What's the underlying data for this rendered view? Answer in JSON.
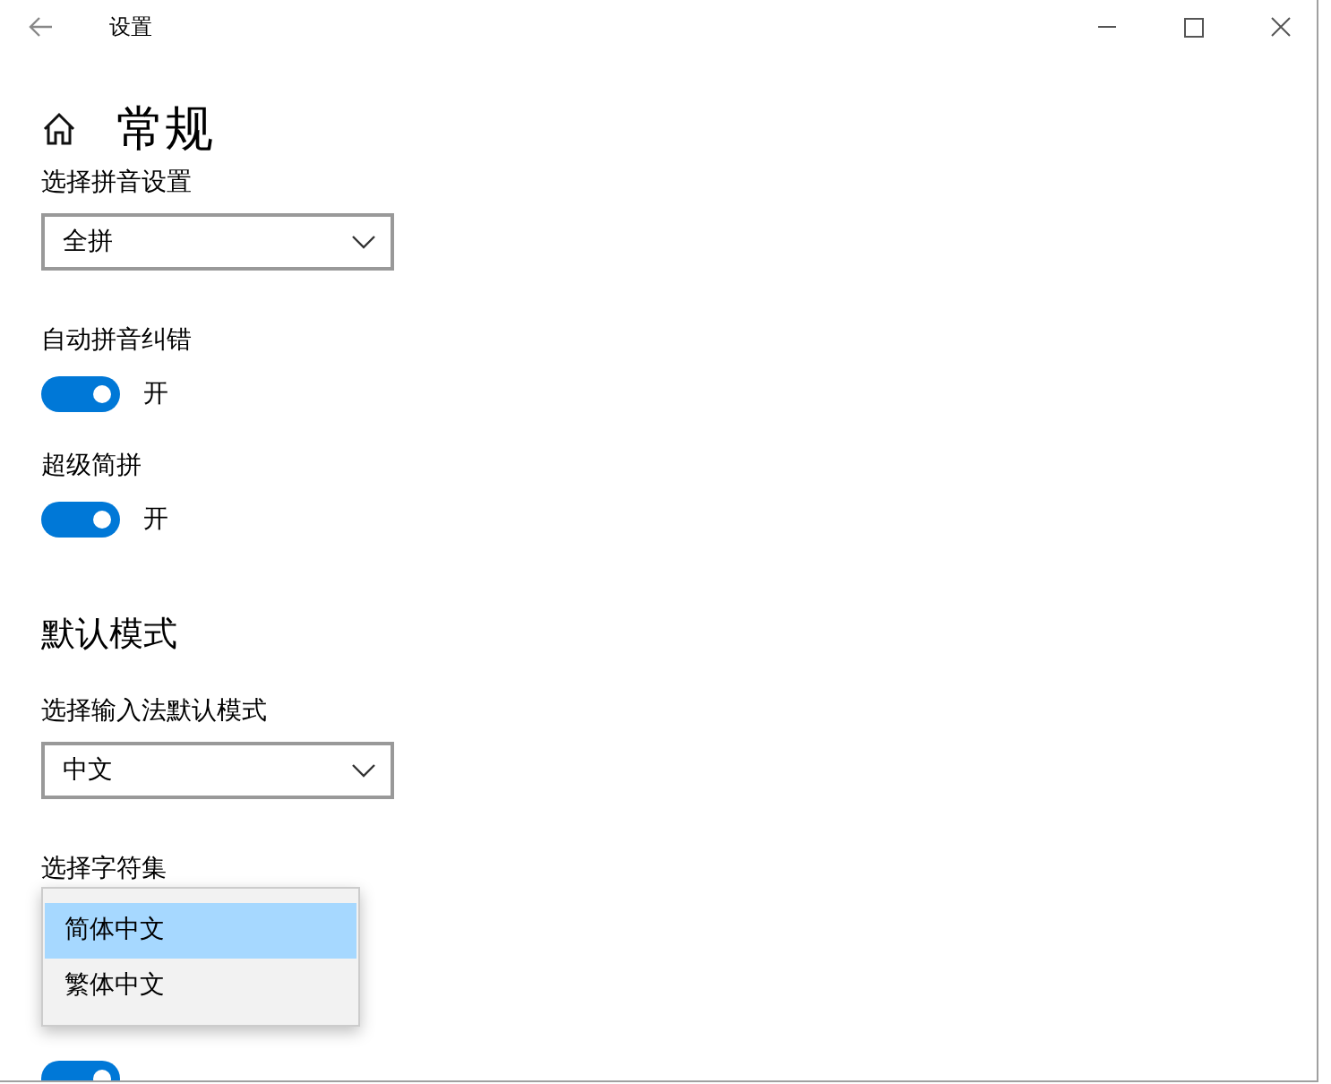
{
  "window": {
    "title": "设置"
  },
  "page_title": "常规",
  "settings": [
    {
      "kind": "dropdown",
      "label": "选择拼音设置",
      "value": "全拼"
    },
    {
      "kind": "toggle",
      "label": "自动拼音纠错",
      "on": true,
      "state_text": "开"
    },
    {
      "kind": "toggle",
      "label": "超级简拼",
      "on": true,
      "state_text": "开"
    },
    {
      "kind": "heading",
      "label": "默认模式"
    },
    {
      "kind": "dropdown",
      "label": "选择输入法默认模式",
      "value": "中文"
    },
    {
      "kind": "open_dropdown",
      "label": "选择字符集",
      "options": [
        {
          "label": "简体中文",
          "selected": true
        },
        {
          "label": "繁体中文",
          "selected": false
        }
      ]
    },
    {
      "kind": "toggle",
      "on": true
    }
  ]
}
